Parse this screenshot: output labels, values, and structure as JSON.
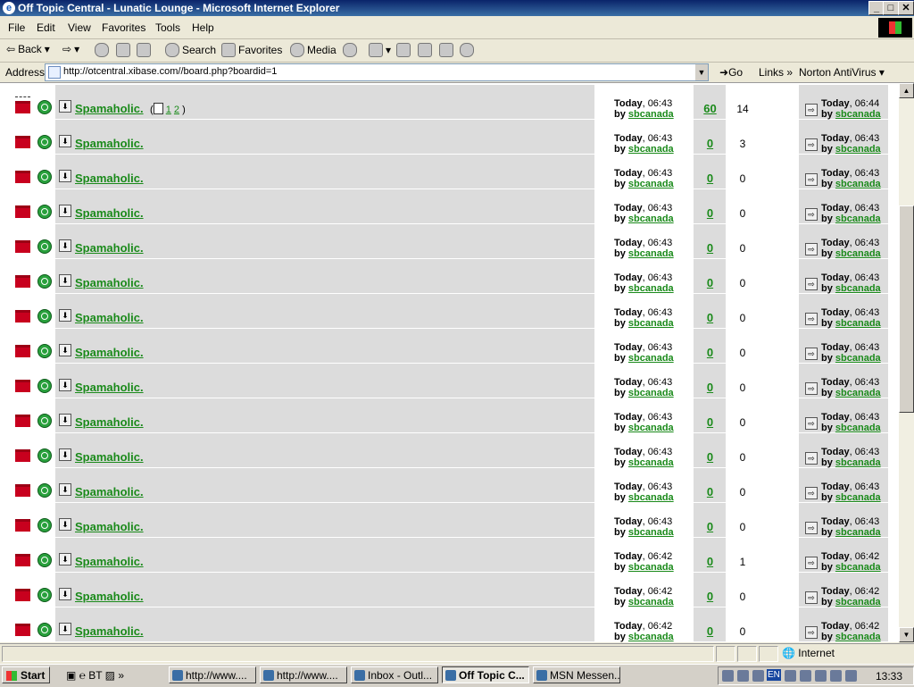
{
  "window": {
    "title": "Off Topic Central - Lunatic Lounge - Microsoft Internet Explorer",
    "controls": [
      "_",
      "□",
      "✕"
    ]
  },
  "menu": [
    "File",
    "Edit",
    "View",
    "Favorites",
    "Tools",
    "Help"
  ],
  "toolbar": {
    "back": "Back",
    "search": "Search",
    "favorites": "Favorites",
    "media": "Media"
  },
  "address": {
    "label": "Address",
    "url": "http://otcentral.xibase.com//board.php?boardid=1",
    "go": "Go",
    "links": "Links",
    "norton": "Norton AntiVirus"
  },
  "threads": [
    {
      "title": "Spamaholic.",
      "pages": [
        "1",
        "2"
      ],
      "started": {
        "day": "Today",
        "time": ", 06:43",
        "by": "by",
        "user": "sbcanada"
      },
      "replies": "60",
      "views": "14",
      "last": {
        "day": "Today",
        "time": ", 06:44",
        "by": "by",
        "user": "sbcanada"
      },
      "hot": true
    },
    {
      "title": "Spamaholic.",
      "started": {
        "day": "Today",
        "time": ", 06:43",
        "by": "by",
        "user": "sbcanada"
      },
      "replies": "0",
      "views": "3",
      "last": {
        "day": "Today",
        "time": ", 06:43",
        "by": "by",
        "user": "sbcanada"
      }
    },
    {
      "title": "Spamaholic.",
      "started": {
        "day": "Today",
        "time": ", 06:43",
        "by": "by",
        "user": "sbcanada"
      },
      "replies": "0",
      "views": "0",
      "last": {
        "day": "Today",
        "time": ", 06:43",
        "by": "by",
        "user": "sbcanada"
      }
    },
    {
      "title": "Spamaholic.",
      "started": {
        "day": "Today",
        "time": ", 06:43",
        "by": "by",
        "user": "sbcanada"
      },
      "replies": "0",
      "views": "0",
      "last": {
        "day": "Today",
        "time": ", 06:43",
        "by": "by",
        "user": "sbcanada"
      }
    },
    {
      "title": "Spamaholic.",
      "started": {
        "day": "Today",
        "time": ", 06:43",
        "by": "by",
        "user": "sbcanada"
      },
      "replies": "0",
      "views": "0",
      "last": {
        "day": "Today",
        "time": ", 06:43",
        "by": "by",
        "user": "sbcanada"
      }
    },
    {
      "title": "Spamaholic.",
      "started": {
        "day": "Today",
        "time": ", 06:43",
        "by": "by",
        "user": "sbcanada"
      },
      "replies": "0",
      "views": "0",
      "last": {
        "day": "Today",
        "time": ", 06:43",
        "by": "by",
        "user": "sbcanada"
      }
    },
    {
      "title": "Spamaholic.",
      "started": {
        "day": "Today",
        "time": ", 06:43",
        "by": "by",
        "user": "sbcanada"
      },
      "replies": "0",
      "views": "0",
      "last": {
        "day": "Today",
        "time": ", 06:43",
        "by": "by",
        "user": "sbcanada"
      }
    },
    {
      "title": "Spamaholic.",
      "started": {
        "day": "Today",
        "time": ", 06:43",
        "by": "by",
        "user": "sbcanada"
      },
      "replies": "0",
      "views": "0",
      "last": {
        "day": "Today",
        "time": ", 06:43",
        "by": "by",
        "user": "sbcanada"
      }
    },
    {
      "title": "Spamaholic.",
      "started": {
        "day": "Today",
        "time": ", 06:43",
        "by": "by",
        "user": "sbcanada"
      },
      "replies": "0",
      "views": "0",
      "last": {
        "day": "Today",
        "time": ", 06:43",
        "by": "by",
        "user": "sbcanada"
      }
    },
    {
      "title": "Spamaholic.",
      "started": {
        "day": "Today",
        "time": ", 06:43",
        "by": "by",
        "user": "sbcanada"
      },
      "replies": "0",
      "views": "0",
      "last": {
        "day": "Today",
        "time": ", 06:43",
        "by": "by",
        "user": "sbcanada"
      }
    },
    {
      "title": "Spamaholic.",
      "started": {
        "day": "Today",
        "time": ", 06:43",
        "by": "by",
        "user": "sbcanada"
      },
      "replies": "0",
      "views": "0",
      "last": {
        "day": "Today",
        "time": ", 06:43",
        "by": "by",
        "user": "sbcanada"
      }
    },
    {
      "title": "Spamaholic.",
      "started": {
        "day": "Today",
        "time": ", 06:43",
        "by": "by",
        "user": "sbcanada"
      },
      "replies": "0",
      "views": "0",
      "last": {
        "day": "Today",
        "time": ", 06:43",
        "by": "by",
        "user": "sbcanada"
      }
    },
    {
      "title": "Spamaholic.",
      "started": {
        "day": "Today",
        "time": ", 06:43",
        "by": "by",
        "user": "sbcanada"
      },
      "replies": "0",
      "views": "0",
      "last": {
        "day": "Today",
        "time": ", 06:43",
        "by": "by",
        "user": "sbcanada"
      }
    },
    {
      "title": "Spamaholic.",
      "started": {
        "day": "Today",
        "time": ", 06:42",
        "by": "by",
        "user": "sbcanada"
      },
      "replies": "0",
      "views": "1",
      "last": {
        "day": "Today",
        "time": ", 06:42",
        "by": "by",
        "user": "sbcanada"
      }
    },
    {
      "title": "Spamaholic.",
      "started": {
        "day": "Today",
        "time": ", 06:42",
        "by": "by",
        "user": "sbcanada"
      },
      "replies": "0",
      "views": "0",
      "last": {
        "day": "Today",
        "time": ", 06:42",
        "by": "by",
        "user": "sbcanada"
      }
    },
    {
      "title": "Spamaholic.",
      "started": {
        "day": "Today",
        "time": ", 06:42",
        "by": "by",
        "user": "sbcanada"
      },
      "replies": "0",
      "views": "0",
      "last": {
        "day": "Today",
        "time": ", 06:42",
        "by": "by",
        "user": "sbcanada"
      }
    }
  ],
  "status": {
    "zone": "Internet"
  },
  "taskbar": {
    "start": "Start",
    "tasks": [
      "http://www....",
      "http://www....",
      "Inbox - Outl...",
      "Off Topic C...",
      "MSN Messen..."
    ],
    "active_index": 3,
    "lang": "EN",
    "clock": "13:33"
  },
  "colors": {
    "link_green": "#1a8a1a",
    "folder_red": "#c8001e",
    "titlebar_blue": "#0a246a"
  }
}
